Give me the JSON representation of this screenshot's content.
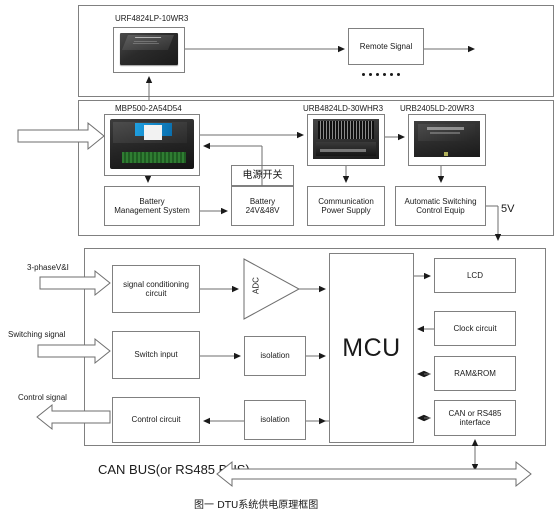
{
  "figure": {
    "caption": "图一  DTU系统供电原理框图",
    "line_color": "#808080",
    "text_color": "#1a1a1a",
    "accent_blue": "#1f9fe0",
    "accent_green": "#2f7d32"
  },
  "top_panel": {
    "module_label": "URF4824LP-10WR3",
    "module_icon": "dc-dc-converter-module-photo",
    "remote_signal_box": "Remote Signal",
    "continuation_dots_count": 6
  },
  "middle_panel": {
    "mbp_label": "MBP500-2A54D54",
    "mbp_icon": "power-supply-enclosure-photo",
    "urb4824_label": "URB4824LD-30WHR3",
    "urb4824_icon": "heatsink-converter-module-photo",
    "urb2405_label": "URB2405LD-20WR3",
    "urb2405_icon": "brick-converter-module-photo",
    "power_switch_cn": "电源开关",
    "boxes": {
      "bms": "Battery\nManagement System",
      "bms_line1": "Battery",
      "bms_line2": "Management System",
      "battery_line1": "Battery",
      "battery_line2": "24V&48V",
      "comm_line1": "Communication",
      "comm_line2": "Power Supply",
      "auto_line1": "Automatic Switching",
      "auto_line2": "Control  Equip"
    },
    "output_voltage": "5V"
  },
  "bottom_panel": {
    "input_labels": {
      "phase": "3-phaseV&I",
      "switching": "Switching signal",
      "control": "Control signal"
    },
    "blocks": {
      "signal_cond_line1": "signal conditioning",
      "signal_cond_line2": "circuit",
      "adc": "ADC",
      "switch_input": "Switch input",
      "isolation_1": "isolation",
      "control_circuit": "Control circuit",
      "isolation_2": "isolation",
      "mcu": "MCU"
    },
    "peripherals": [
      {
        "label": "LCD"
      },
      {
        "label": "Clock circuit"
      },
      {
        "label": "RAM&ROM"
      },
      {
        "label": "CAN or RS485\ninterface",
        "line1": "CAN or RS485",
        "line2": "interface"
      }
    ],
    "bus_label": "CAN BUS(or RS485 BUS)"
  }
}
